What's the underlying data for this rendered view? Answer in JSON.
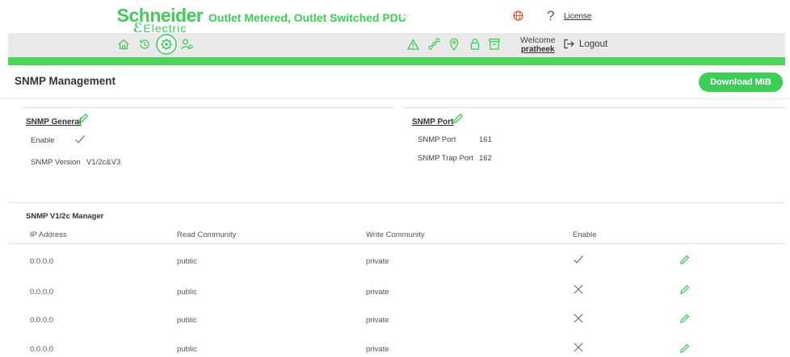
{
  "header": {
    "brand_name": "Schneider",
    "brand_sub": "Electric",
    "product_title": "Outlet Metered, Outlet Switched PDU",
    "license_label": "License",
    "welcome_label": "Welcome",
    "username": "pratheek",
    "logout_label": "Logout"
  },
  "toolbar": {
    "left_icons": [
      "home-icon",
      "history-icon",
      "settings-icon",
      "users-icon"
    ],
    "right_icons": [
      "alarm-icon",
      "network-icon",
      "location-icon",
      "lock-icon",
      "archive-icon"
    ]
  },
  "page": {
    "title": "SNMP Management",
    "download_label": "Download MIB"
  },
  "snmp_general": {
    "title": "SNMP General",
    "enable_label": "Enable",
    "enabled": true,
    "version_label": "SNMP Version",
    "version_value": "V1/2c&V3"
  },
  "snmp_port": {
    "title": "SNMP Port",
    "port_label": "SNMP Port",
    "port_value": "161",
    "trap_label": "SNMP Trap Port",
    "trap_value": "162"
  },
  "manager": {
    "title": "SNMP V1/2c Manager",
    "columns": [
      "IP Address",
      "Read Community",
      "Write Community",
      "Enable"
    ],
    "rows": [
      {
        "ip": "0.0.0.0",
        "read": "public",
        "write": "private",
        "enabled": true
      },
      {
        "ip": "0.0.0.0",
        "read": "public",
        "write": "private",
        "enabled": false
      },
      {
        "ip": "0.0.0.0",
        "read": "public",
        "write": "private",
        "enabled": false
      },
      {
        "ip": "0.0.0.0",
        "read": "public",
        "write": "private",
        "enabled": false
      }
    ]
  },
  "colors": {
    "brand_green": "#3dcd58",
    "bar_green": "#4cd35a",
    "toolbar_gray": "#eaeaea",
    "lang_icon": "#e8542f"
  }
}
